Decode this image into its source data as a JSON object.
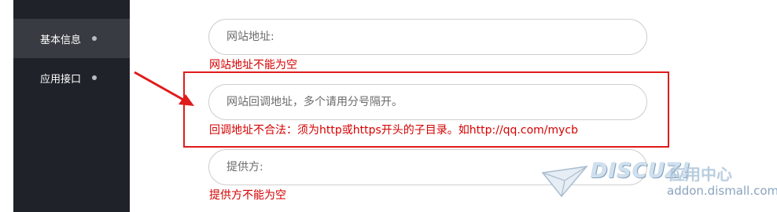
{
  "sidebar": {
    "items": [
      {
        "label": "基本信息",
        "active": true
      },
      {
        "label": "应用接口",
        "active": false
      }
    ]
  },
  "form": {
    "site_url": {
      "placeholder": "网站地址:",
      "error": "网站地址不能为空"
    },
    "callback_url": {
      "placeholder": "网站回调地址，多个请用分号隔开。",
      "error": "回调地址不合法：须为http或https开头的子目录。如http://qq.com/mycb"
    },
    "provider": {
      "placeholder": "提供方:",
      "error": "提供方不能为空"
    }
  },
  "annotation": {
    "highlight_color": "#e01b1b"
  },
  "watermark": {
    "brand": "DISCUZ!",
    "label": "应用中心",
    "domain": "addon.dismall.com"
  },
  "colors": {
    "sidebar_bg": "#1f2329",
    "sidebar_active": "#383c42",
    "error": "#d60000"
  }
}
